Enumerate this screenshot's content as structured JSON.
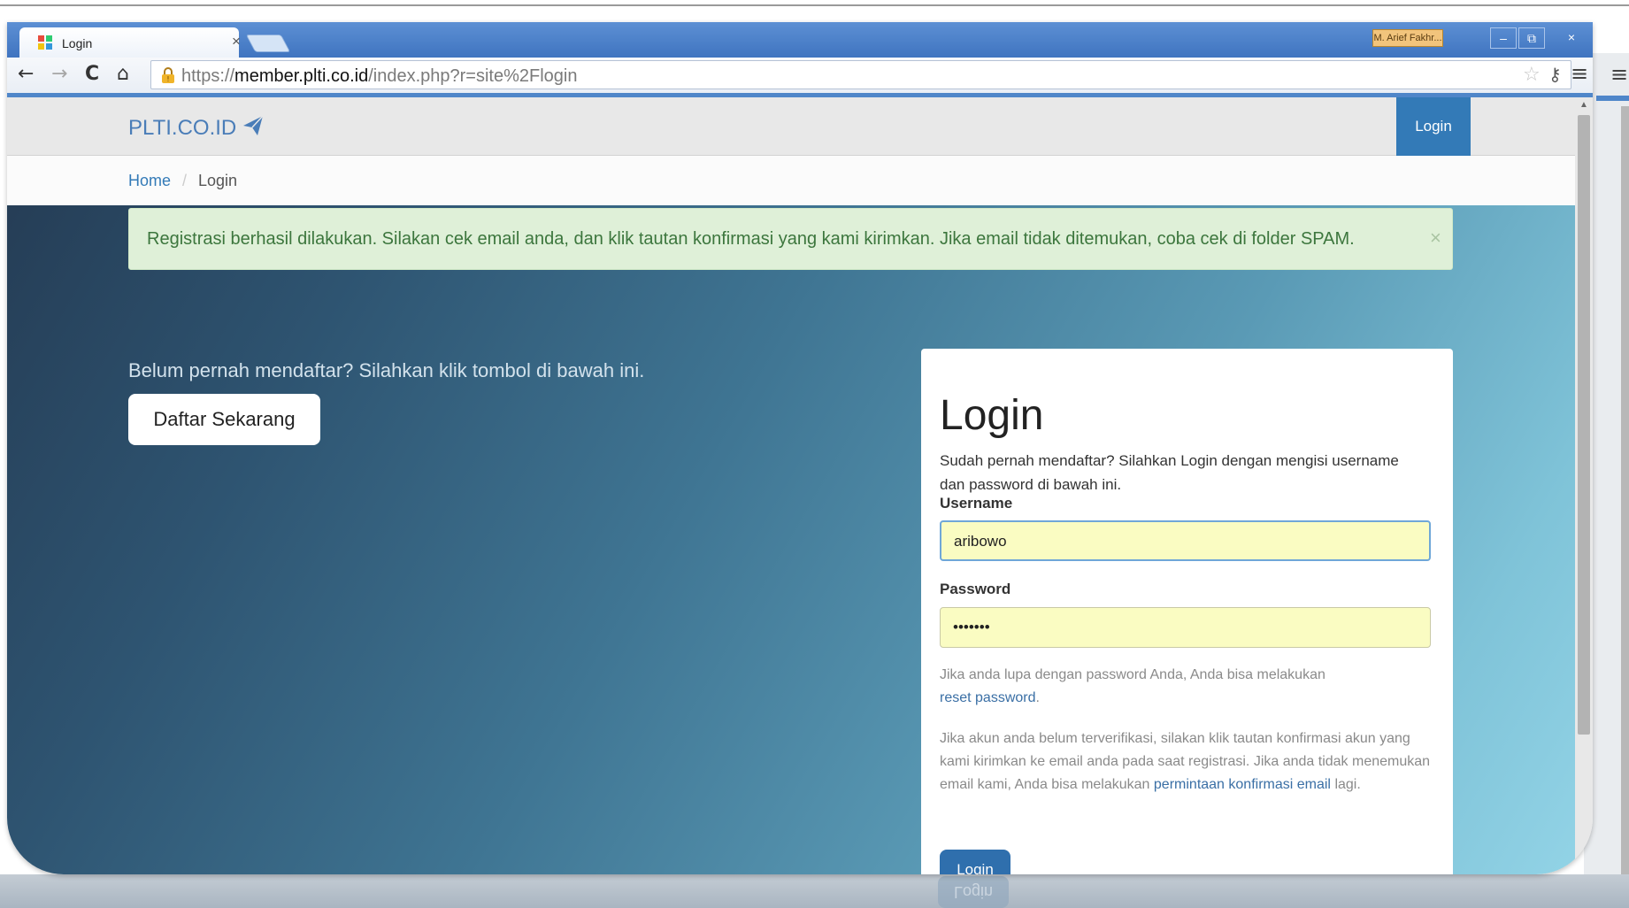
{
  "browser": {
    "tab_title": "Login",
    "tab_close": "×",
    "user_badge": "M. Arief Fakhr...",
    "url_prefix": "https://",
    "url_domain": "member.plti.co.id",
    "url_path": "/index.php?r=site%2Flogin",
    "win_min": "–",
    "win_max": "⧉",
    "win_close": "×",
    "icons": [
      "back-arrow-icon",
      "forward-arrow-icon",
      "reload-icon",
      "home-icon",
      "lock-icon",
      "star-icon",
      "key-icon",
      "menu-icon"
    ]
  },
  "navbar": {
    "brand": "PLTI.CO.ID",
    "login": "Login",
    "brand_color": "#4a7db8",
    "accent_color": "#337ab7"
  },
  "breadcrumb": {
    "home": "Home",
    "separator": "/",
    "current": "Login"
  },
  "alert": {
    "message": "Registrasi berhasil dilakukan. Silakan cek email anda, dan klik tautan konfirmasi yang kami kirimkan. Jika email tidak ditemukan, coba cek di folder SPAM.",
    "close": "×",
    "color": "#dff0d8"
  },
  "register": {
    "prompt": "Belum pernah mendaftar? Silahkan klik tombol di bawah ini.",
    "button": "Daftar Sekarang"
  },
  "login_form": {
    "title": "Login",
    "intro": "Sudah pernah mendaftar? Silahkan Login dengan mengisi username dan password di bawah ini.",
    "username_label": "Username",
    "username_value": "aribowo",
    "password_label": "Password",
    "password_value": "•••••••",
    "forgot_text": "Jika anda lupa dengan password Anda, Anda bisa melakukan",
    "forgot_link": "reset password",
    "forgot_end": ".",
    "verify_text": "Jika akun anda belum terverifikasi, silakan klik tautan konfirmasi akun yang kami kirimkan ke email anda pada saat registrasi. Jika anda tidak menemukan email kami, Anda bisa melakukan",
    "verify_link": "permintaan konfirmasi email",
    "verify_end": "lagi.",
    "submit": "Login"
  }
}
